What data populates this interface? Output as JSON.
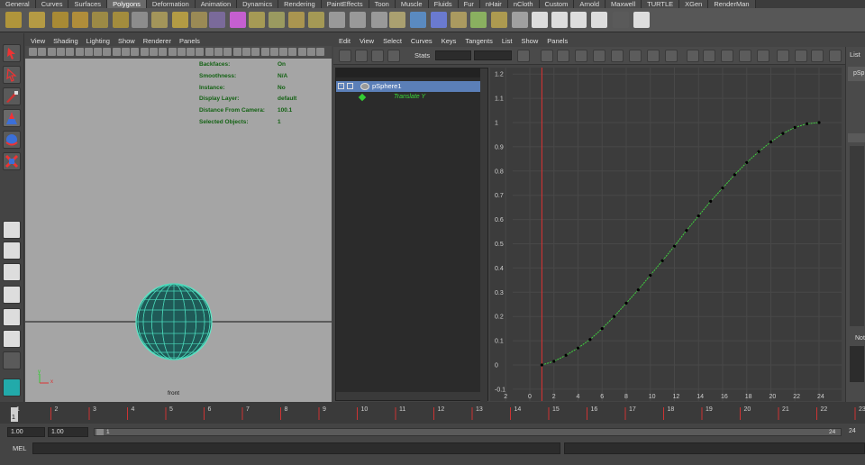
{
  "shelf_tabs": [
    "General",
    "Curves",
    "Surfaces",
    "Polygons",
    "Deformation",
    "Animation",
    "Dynamics",
    "Rendering",
    "PaintEffects",
    "Toon",
    "Muscle",
    "Fluids",
    "Fur",
    "nHair",
    "nCloth",
    "Custom",
    "Arnold",
    "Maxwell",
    "TURTLE",
    "XGen",
    "RenderMan"
  ],
  "active_shelf_tab": "Polygons",
  "viewport": {
    "menu": [
      "View",
      "Shading",
      "Lighting",
      "Show",
      "Renderer",
      "Panels"
    ],
    "hud": [
      {
        "label": "Backfaces:",
        "value": "On"
      },
      {
        "label": "Smoothness:",
        "value": "N/A"
      },
      {
        "label": "Instance:",
        "value": "No"
      },
      {
        "label": "Display Layer:",
        "value": "default"
      },
      {
        "label": "Distance From Camera:",
        "value": "100.1"
      },
      {
        "label": "Selected Objects:",
        "value": "1"
      }
    ],
    "camera_label": "front",
    "axis_y": "y",
    "axis_x": "x"
  },
  "graph_editor": {
    "menu": [
      "Edit",
      "View",
      "Select",
      "Curves",
      "Keys",
      "Tangents",
      "List",
      "Show",
      "Panels"
    ],
    "stats_label": "Stats",
    "outliner": {
      "object": "pSphere1",
      "attribute": "Translate Y"
    },
    "curve_color": "#3fd03f",
    "key_color": "#000000",
    "current_time_color": "#e23030",
    "y_ticks": [
      "1.2",
      "1.1",
      "1",
      "0.9",
      "0.8",
      "0.7",
      "0.6",
      "0.5",
      "0.4",
      "0.3",
      "0.2",
      "0.1",
      "0",
      "-0.1",
      "-0.2"
    ],
    "x_ticks": [
      "2",
      "0",
      "2",
      "4",
      "6",
      "8",
      "10",
      "12",
      "14",
      "16",
      "18",
      "20",
      "22",
      "24"
    ]
  },
  "chart_data": {
    "type": "line",
    "title": "",
    "xlabel": "",
    "ylabel": "",
    "xlim": [
      -2,
      25
    ],
    "ylim": [
      -0.2,
      1.25
    ],
    "series": [
      {
        "x": [
          1,
          2,
          3,
          4,
          5,
          6,
          7,
          8,
          9,
          10,
          11,
          12,
          13,
          14,
          15,
          16,
          17,
          18,
          19,
          20,
          21,
          22,
          23,
          24
        ],
        "values": [
          0,
          0.015,
          0.04,
          0.07,
          0.105,
          0.15,
          0.2,
          0.255,
          0.31,
          0.37,
          0.43,
          0.49,
          0.555,
          0.615,
          0.675,
          0.73,
          0.785,
          0.835,
          0.88,
          0.92,
          0.955,
          0.98,
          0.995,
          1.0
        ]
      }
    ],
    "current_time": 1
  },
  "right_panel": {
    "list_label": "List",
    "tab_label": "pSp",
    "notes_label": "Not"
  },
  "time_slider": {
    "ticks": [
      "1",
      "2",
      "3",
      "4",
      "5",
      "6",
      "7",
      "8",
      "9",
      "10",
      "11",
      "12",
      "13",
      "14",
      "15",
      "16",
      "17",
      "18",
      "19",
      "20",
      "21",
      "22",
      "23",
      "24"
    ],
    "current_frame": "1",
    "end_label": "24"
  },
  "range": {
    "start_field": "1.00",
    "playback_start": "1.00",
    "slider_start": "1",
    "slider_end": "24",
    "end_field": "24"
  },
  "command_line": {
    "label": "MEL"
  }
}
